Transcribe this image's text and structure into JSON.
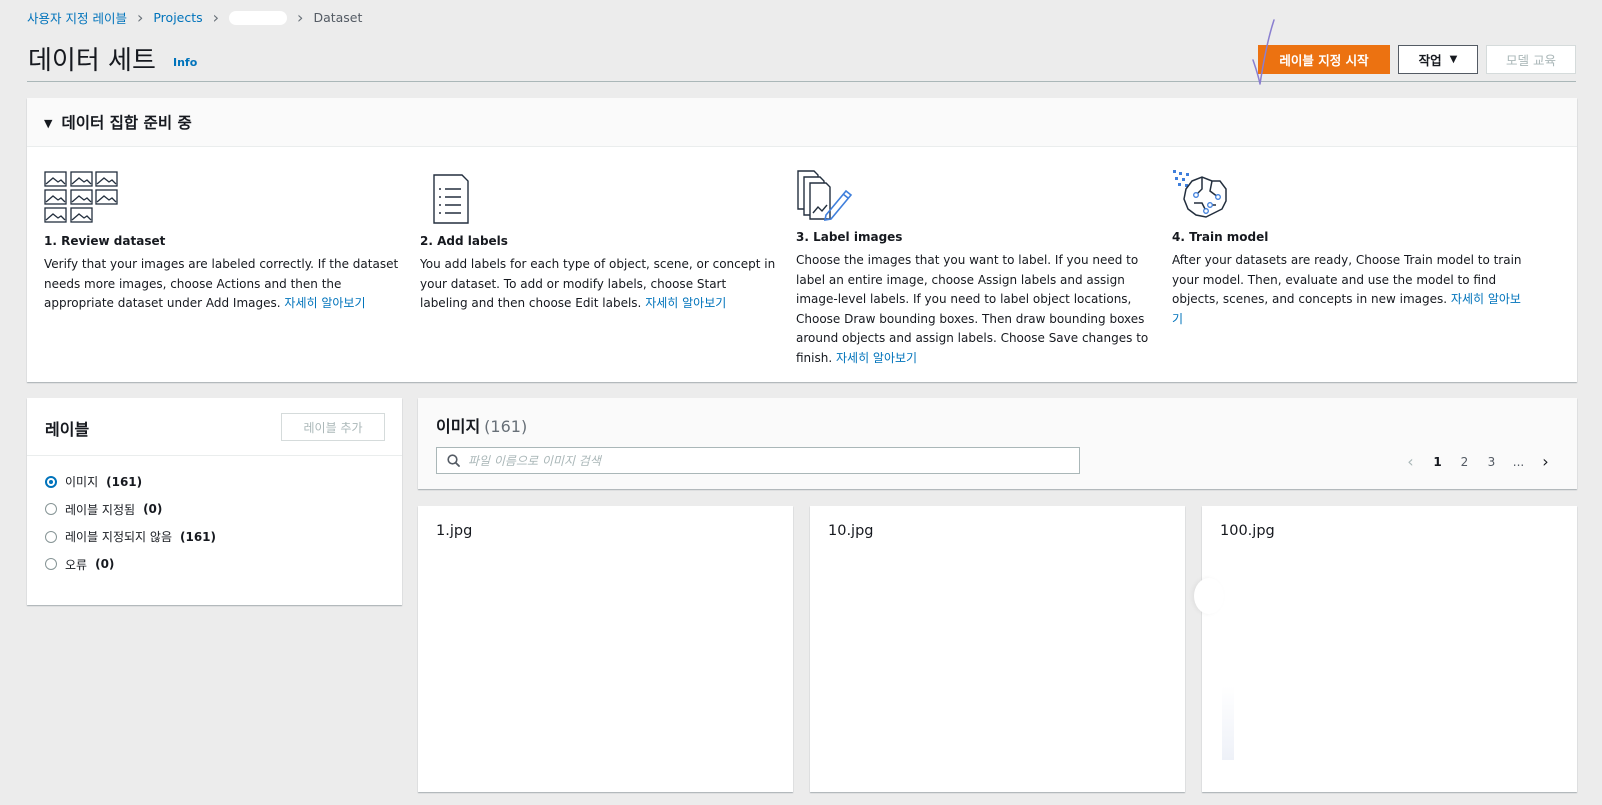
{
  "breadcrumb": {
    "items": [
      "사용자 지정 레이블",
      "Projects"
    ],
    "current": "Dataset"
  },
  "header": {
    "title": "데이터 세트",
    "info": "Info",
    "start_labeling": "레이블 지정 시작",
    "actions": "작업",
    "train_model": "모델 교육"
  },
  "prep": {
    "title": "데이터 집합 준비 중",
    "steps": [
      {
        "title": "1. Review dataset",
        "text": "Verify that your images are labeled correctly. If the dataset needs more images, choose Actions and then the appropriate dataset under Add Images.",
        "link": "자세히 알아보기",
        "icon": "image-grid-icon"
      },
      {
        "title": "2. Add labels",
        "text": "You add labels for each type of object, scene, or concept in your dataset. To add or modify labels, choose Start labeling and then choose Edit labels.",
        "link": "자세히 알아보기",
        "icon": "list-document-icon"
      },
      {
        "title": "3. Label images",
        "text": "Choose the images that you want to label. If you need to label an entire image, choose Assign labels and assign image-level labels. If you need to label object locations, Choose Draw bounding boxes. Then draw bounding boxes around objects and assign labels. Choose Save changes to finish.",
        "link": "자세히 알아보기",
        "icon": "pencil-images-icon"
      },
      {
        "title": "4. Train model",
        "text": "After your datasets are ready, Choose Train model to train your model. Then, evaluate and use the model to find objects, scenes, and concepts in new images.",
        "link": "자세히 알아보기",
        "icon": "brain-icon"
      }
    ]
  },
  "labels": {
    "title": "레이블",
    "add_button": "레이블 추가",
    "filters": [
      {
        "label": "이미지",
        "count": "(161)",
        "checked": true
      },
      {
        "label": "레이블 지정됨",
        "count": "(0)",
        "checked": false
      },
      {
        "label": "레이블 지정되지 않음",
        "count": "(161)",
        "checked": false
      },
      {
        "label": "오류",
        "count": "(0)",
        "checked": false
      }
    ]
  },
  "images": {
    "title": "이미지",
    "count": "(161)",
    "search_placeholder": "파일 이름으로 이미지 검색",
    "pages": [
      "1",
      "2",
      "3",
      "..."
    ],
    "files": [
      "1.jpg",
      "10.jpg",
      "100.jpg"
    ]
  },
  "colors": {
    "accent": "#ec7211",
    "link": "#0073bb"
  }
}
